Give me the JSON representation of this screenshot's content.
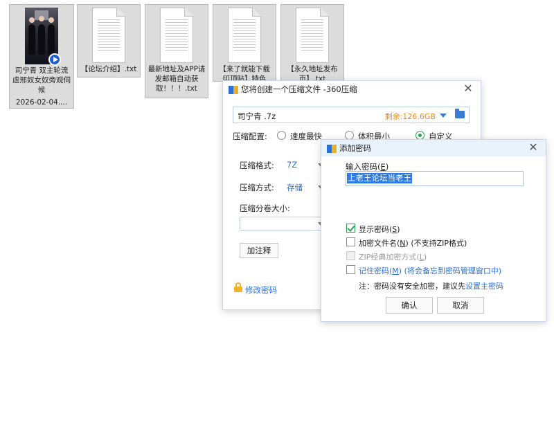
{
  "desktop_files": [
    {
      "name": "司宁青 双主轮流虐邢奴女奴旁观伺候",
      "date": "2026-02-04...."
    },
    {
      "name": "【论坛介绍】.txt"
    },
    {
      "name": "最新地址及APP请发邮箱自动获取！！！.txt"
    },
    {
      "name_l1": "【来了就能下载",
      "name_l2": "印顶贴】特色"
    },
    {
      "name_l1": "【永久地址发布",
      "name_l2": "页】.txt"
    }
  ],
  "compress_dialog": {
    "title": "您将创建一个压缩文件 -360压缩",
    "close": "✕",
    "filename": "司宁青 .7z",
    "free_space": "剩余:126.6GB",
    "config_label": "压缩配置:",
    "radio_options": [
      "速度最快",
      "体积最小",
      "自定义"
    ],
    "format_label": "压缩格式:",
    "format_value": "7Z",
    "method_label": "压缩方式:",
    "method_value": "存储",
    "split_label": "压缩分卷大小:",
    "split_value": "",
    "comment_button": "加注释",
    "change_password_link": "修改密码"
  },
  "password_dialog": {
    "title": "添加密码",
    "close": "✕",
    "input_label_prefix": "输入密码(",
    "input_label_key": "E",
    "input_label_suffix": ")",
    "password_value": "上老王论坛当老王",
    "show_password_prefix": "显示密码(",
    "show_password_key": "S",
    "show_password_suffix": ")",
    "encrypt_names_prefix": "加密文件名(",
    "encrypt_names_key": "N",
    "encrypt_names_suffix": ") (不支持ZIP格式)",
    "zip_classic_prefix": "ZIP经典加密方式(",
    "zip_classic_key": "L",
    "zip_classic_suffix": ")",
    "remember_prefix": "记住密码(",
    "remember_key": "M",
    "remember_suffix": ") (将会备忘到密码管理窗口中)",
    "note_text": "注：密码没有安全加密，建议先",
    "note_link": "设置主密码",
    "ok_button": "确认",
    "cancel_button": "取消"
  },
  "colors": {
    "accent": "#2a6fd6",
    "check_green": "#2aa14a",
    "free_space": "#e88b1a",
    "selection": "#2f7be5"
  }
}
